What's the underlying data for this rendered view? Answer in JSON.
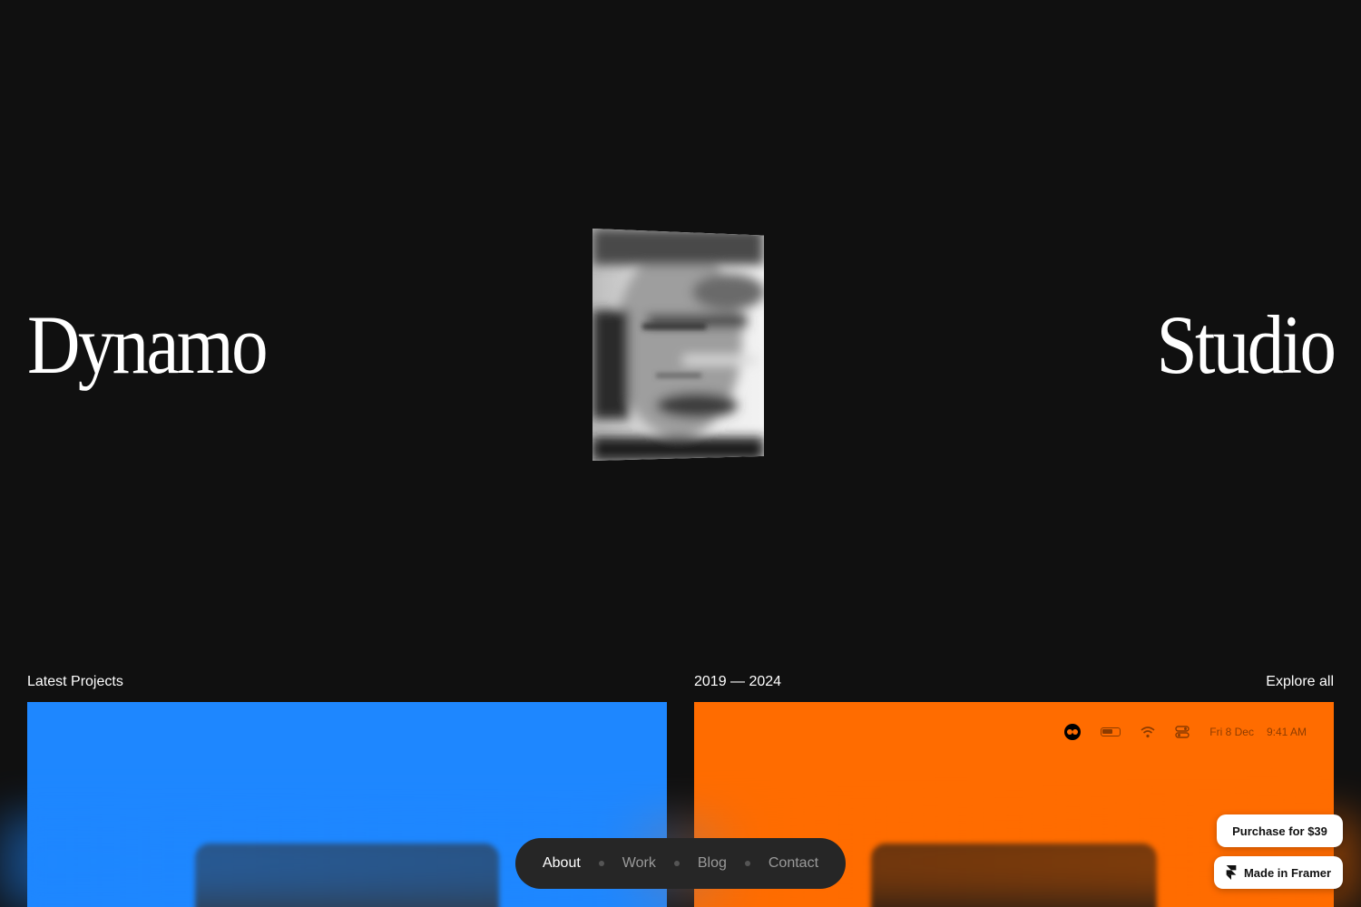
{
  "hero": {
    "left_word": "Dynamo",
    "right_word": "Studio"
  },
  "projects": {
    "heading": "Latest Projects",
    "range": "2019 — 2024",
    "explore_link": "Explore all",
    "status_bar": {
      "date": "Fri 8 Dec",
      "time": "9:41 AM"
    }
  },
  "nav": {
    "items": [
      {
        "label": "About",
        "active": true
      },
      {
        "label": "Work",
        "active": false
      },
      {
        "label": "Blog",
        "active": false
      },
      {
        "label": "Contact",
        "active": false
      }
    ]
  },
  "framer": {
    "purchase_label": "Purchase for $39",
    "made_in_label": "Made in Framer"
  },
  "colors": {
    "background": "#101010",
    "card_blue": "#1e87ff",
    "card_orange": "#ff6c00",
    "nav_bg": "#262626"
  }
}
